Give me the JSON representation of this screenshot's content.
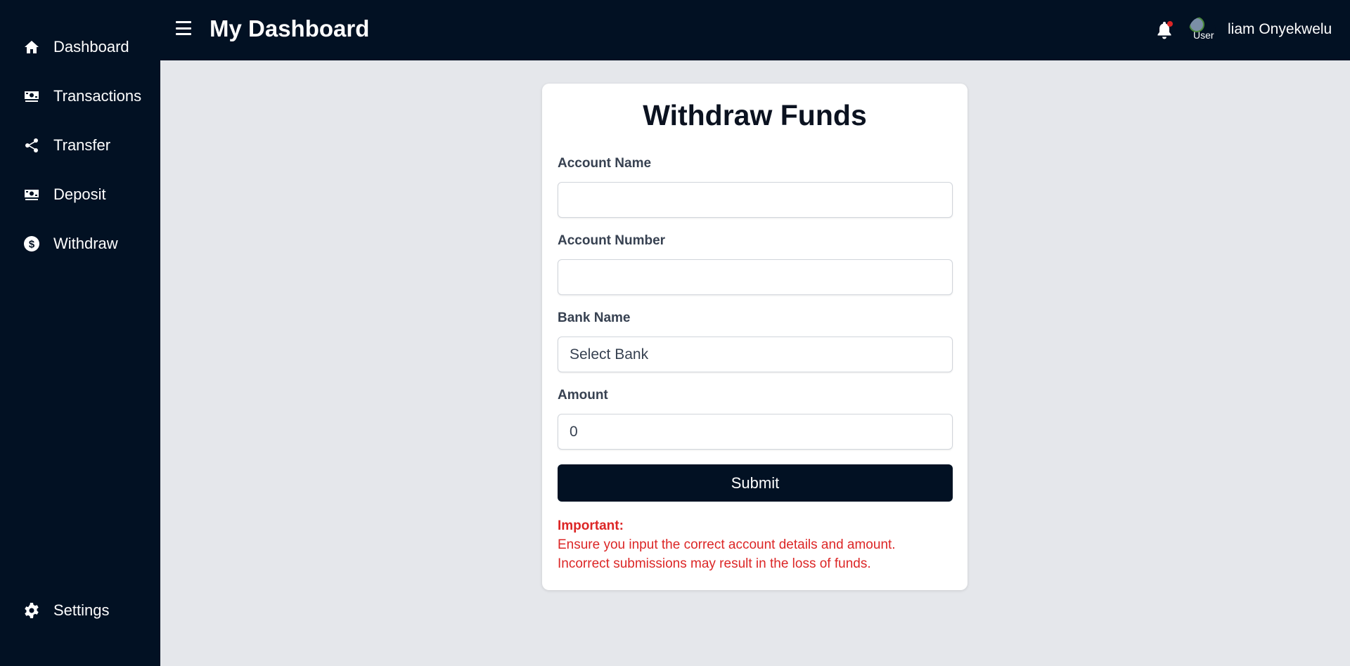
{
  "sidebar": {
    "items": [
      {
        "label": "Dashboard",
        "icon": "home-icon"
      },
      {
        "label": "Transactions",
        "icon": "money-bill-icon"
      },
      {
        "label": "Transfer",
        "icon": "share-icon"
      },
      {
        "label": "Deposit",
        "icon": "money-bill-icon"
      },
      {
        "label": "Withdraw",
        "icon": "dollar-circle-icon"
      }
    ],
    "settings": {
      "label": "Settings",
      "icon": "gear-icon"
    }
  },
  "header": {
    "title": "My Dashboard",
    "avatar_alt": "User",
    "user_name": "liam Onyekwelu",
    "notification_dot_color": "#dc2626"
  },
  "form": {
    "title": "Withdraw Funds",
    "account_name": {
      "label": "Account Name",
      "value": ""
    },
    "account_number": {
      "label": "Account Number",
      "value": ""
    },
    "bank_name": {
      "label": "Bank Name",
      "selected": "Select Bank"
    },
    "amount": {
      "label": "Amount",
      "value": "0"
    },
    "submit_label": "Submit",
    "notice": {
      "title": "Important:",
      "line1": "Ensure you input the correct account details and amount.",
      "line2": "Incorrect submissions may result in the loss of funds."
    }
  },
  "colors": {
    "sidebar_bg": "#021123",
    "page_bg": "#e5e7eb",
    "warning": "#dc2626"
  }
}
